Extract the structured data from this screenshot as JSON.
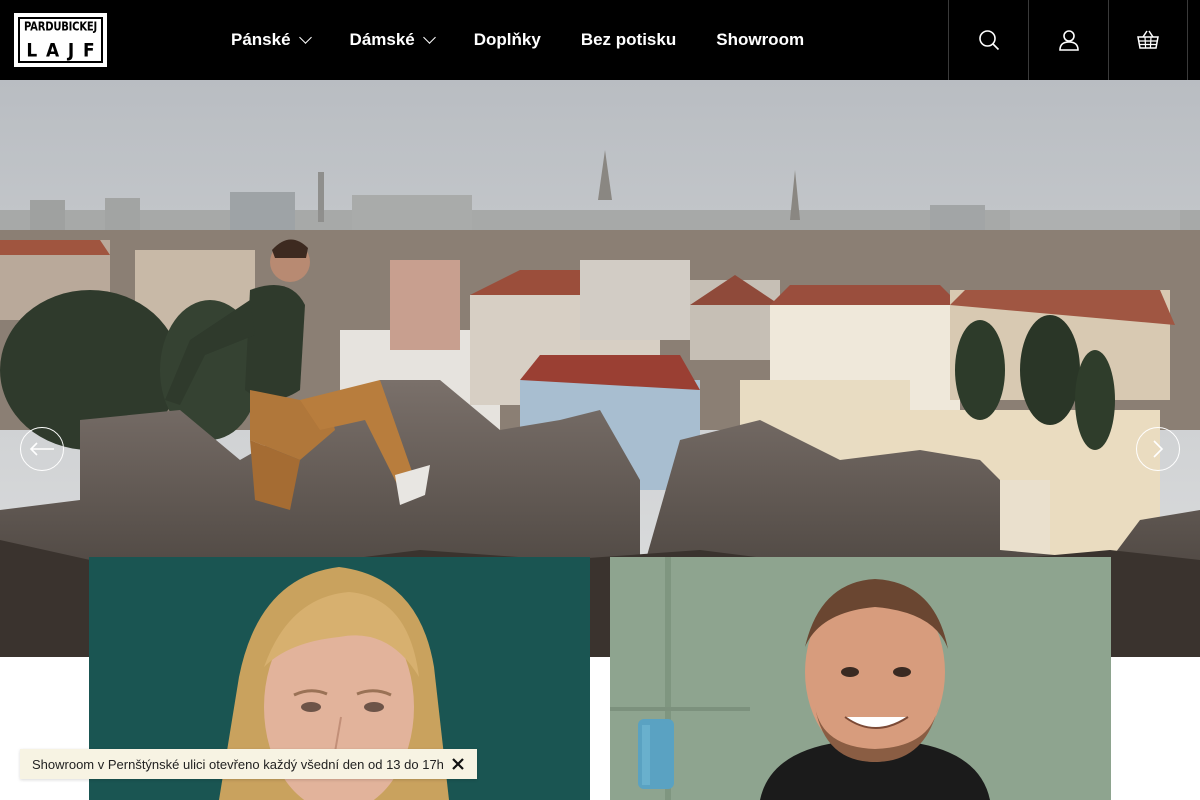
{
  "brand": {
    "logo_line1": "PARDUBICKEJ",
    "logo_line2": [
      "L",
      "A",
      "J",
      "F"
    ]
  },
  "nav": {
    "items": [
      {
        "label": "Pánské",
        "has_dropdown": true
      },
      {
        "label": "Dámské",
        "has_dropdown": true
      },
      {
        "label": "Doplňky",
        "has_dropdown": false
      },
      {
        "label": "Bez potisku",
        "has_dropdown": false
      },
      {
        "label": "Showroom",
        "has_dropdown": false
      }
    ]
  },
  "header_icons": [
    "search-icon",
    "user-icon",
    "basket-icon"
  ],
  "hero": {
    "prev_icon": "arrow-left-icon",
    "next_icon": "chevron-right-icon"
  },
  "notice": {
    "text": "Showroom v Pernštýnské ulici otevřeno každý všední den od 13 do 17h",
    "close_icon": "close-icon"
  },
  "colors": {
    "header_bg": "#000000",
    "notice_bg": "#f7f3e3"
  }
}
